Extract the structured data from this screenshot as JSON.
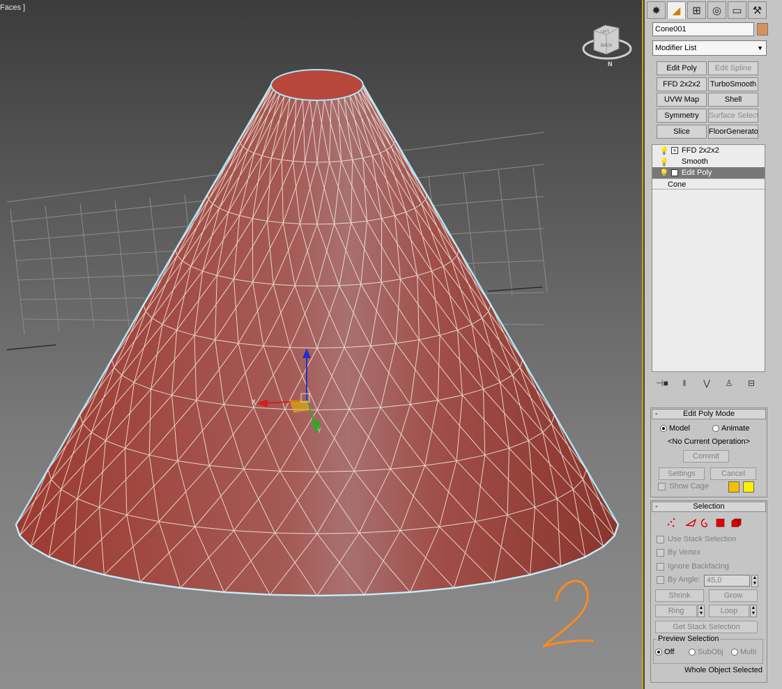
{
  "viewport": {
    "label": "Faces ]",
    "viewcube_face": "BACK",
    "viewcube_top": "LEFT",
    "compass_letter": "N",
    "gizmo_x_label": "X",
    "gizmo_y_label": "Y",
    "annotation": "2",
    "colors": {
      "mesh": "#b0463a",
      "wire": "#f4ece0",
      "selection_outline": "#a8e8ff",
      "annotation": "#ff8a1c"
    }
  },
  "panel": {
    "tabs": [
      {
        "name": "create-tab",
        "glyph": "✸"
      },
      {
        "name": "modify-tab",
        "glyph": "◢"
      },
      {
        "name": "hierarchy-tab",
        "glyph": "⊞"
      },
      {
        "name": "motion-tab",
        "glyph": "◎"
      },
      {
        "name": "display-tab",
        "glyph": "▭"
      },
      {
        "name": "utilities-tab",
        "glyph": "⚒"
      }
    ],
    "object_name": "Cone001",
    "object_color": "#d9905a",
    "modifier_list": "Modifier List",
    "modifier_buttons": [
      {
        "label": "Edit Poly",
        "enabled": true
      },
      {
        "label": "Edit Spline",
        "enabled": false
      },
      {
        "label": "FFD 2x2x2",
        "enabled": true
      },
      {
        "label": "TurboSmooth",
        "enabled": true
      },
      {
        "label": "UVW Map",
        "enabled": true
      },
      {
        "label": "Shell",
        "enabled": true
      },
      {
        "label": "Symmetry",
        "enabled": true
      },
      {
        "label": "Surface Select",
        "enabled": false
      },
      {
        "label": "Slice",
        "enabled": true
      },
      {
        "label": "FloorGenerator",
        "enabled": true
      }
    ],
    "stack": {
      "ffd": "FFD 2x2x2",
      "smooth": "Smooth",
      "edit_poly": "Edit Poly",
      "base": "Cone"
    },
    "stack_icons": [
      "⊣■",
      "‖",
      "⋁",
      "♙",
      "⊟"
    ],
    "edit_poly_mode": {
      "title": "Edit Poly Mode",
      "model": "Model",
      "animate": "Animate",
      "operation": "<No Current Operation>",
      "commit": "Commit",
      "settings": "Settings",
      "cancel": "Cancel",
      "show_cage": "Show Cage"
    },
    "selection": {
      "title": "Selection",
      "use_stack_selection": "Use Stack Selection",
      "by_vertex": "By Vertex",
      "ignore_backfacing": "Ignore Backfacing",
      "by_angle": "By Angle:",
      "angle_value": "45,0",
      "shrink": "Shrink",
      "grow": "Grow",
      "ring": "Ring",
      "loop": "Loop",
      "get_stack_selection": "Get Stack Selection",
      "preview_selection": "Preview Selection",
      "off": "Off",
      "subobj": "SubObj",
      "multi": "Multi",
      "status": "Whole Object Selected"
    }
  }
}
